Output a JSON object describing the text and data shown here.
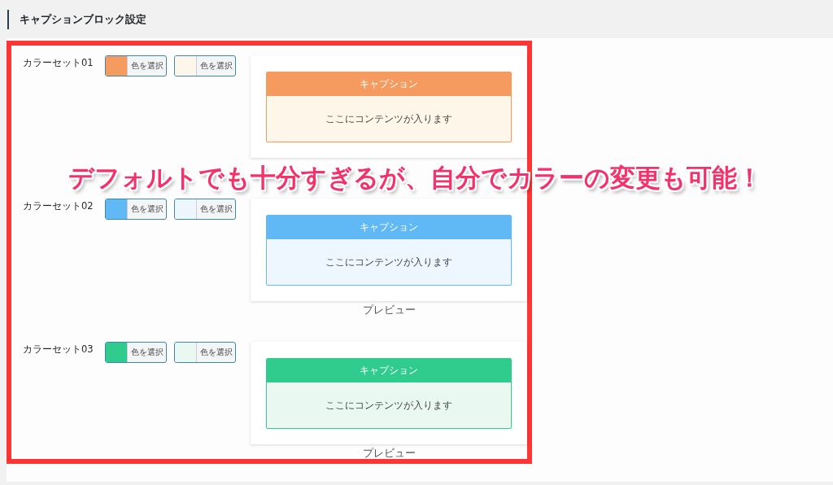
{
  "page_title": "キャプションブロック設定",
  "color_sets": [
    {
      "label": "カラーセット01",
      "swatches": [
        {
          "color": "#f59b5f",
          "button": "色を選択"
        },
        {
          "color": "#fff6ea",
          "button": "色を選択"
        }
      ],
      "preview": {
        "caption": "キャプション",
        "content": "ここにコンテンツが入ります"
      }
    },
    {
      "label": "カラーセット02",
      "swatches": [
        {
          "color": "#60b8f5",
          "button": "色を選択"
        },
        {
          "color": "#eef6ff",
          "button": "色を選択"
        }
      ],
      "preview": {
        "caption": "キャプション",
        "content": "ここにコンテンツが入ります",
        "label": "プレビュー"
      }
    },
    {
      "label": "カラーセット03",
      "swatches": [
        {
          "color": "#30cc8e",
          "button": "色を選択"
        },
        {
          "color": "#e9f8f1",
          "button": "色を選択"
        }
      ],
      "preview": {
        "caption": "キャプション",
        "content": "ここにコンテンツが入ります",
        "label": "プレビュー"
      }
    }
  ],
  "annotation": "デフォルトでも十分すぎるが、自分でカラーの変更も可能！"
}
